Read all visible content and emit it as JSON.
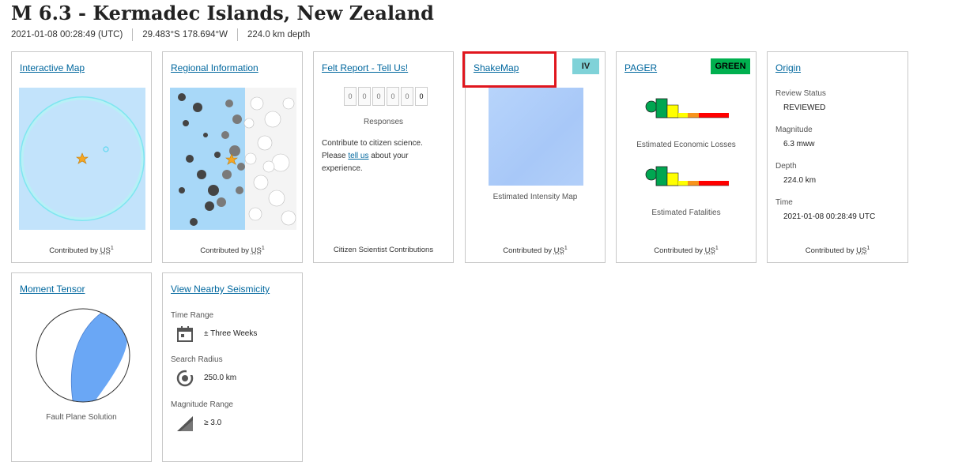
{
  "event": {
    "title": "M 6.3 - Kermadec Islands, New Zealand",
    "time": "2021-01-08 00:28:49 (UTC)",
    "location": "29.483°S 178.694°W",
    "depth": "224.0 km depth"
  },
  "contributed": {
    "prefix": "Contributed by",
    "network": "US",
    "sup": "1"
  },
  "cards": {
    "interactive_map": {
      "title": "Interactive Map"
    },
    "regional": {
      "title": "Regional Information"
    },
    "felt": {
      "title": "Felt Report - Tell Us!",
      "counter": [
        "0",
        "0",
        "0",
        "0",
        "0",
        "0"
      ],
      "responses_label": "Responses",
      "text_before": "Contribute to citizen science. Please",
      "link": "tell us",
      "text_after": "about your experience.",
      "footer": "Citizen Scientist Contributions"
    },
    "shakemap": {
      "title": "ShakeMap",
      "intensity": "IV",
      "intensity_color": "#7fd2d8",
      "caption": "Estimated Intensity Map"
    },
    "pager": {
      "title": "PAGER",
      "alert": "GREEN",
      "alert_color": "#00b04f",
      "losses_caption": "Estimated Economic Losses",
      "fatalities_caption": "Estimated Fatalities"
    },
    "origin": {
      "title": "Origin",
      "review_label": "Review Status",
      "review_value": "REVIEWED",
      "magnitude_label": "Magnitude",
      "magnitude_value": "6.3 mww",
      "depth_label": "Depth",
      "depth_value": "224.0 km",
      "time_label": "Time",
      "time_value": "2021-01-08 00:28:49 UTC"
    },
    "moment_tensor": {
      "title": "Moment Tensor",
      "caption": "Fault Plane Solution"
    },
    "nearby": {
      "title": "View Nearby Seismicity",
      "time_label": "Time Range",
      "time_value": "± Three Weeks",
      "radius_label": "Search Radius",
      "radius_value": "250.0 km",
      "mag_label": "Magnitude Range",
      "mag_value": "≥ 3.0"
    }
  }
}
